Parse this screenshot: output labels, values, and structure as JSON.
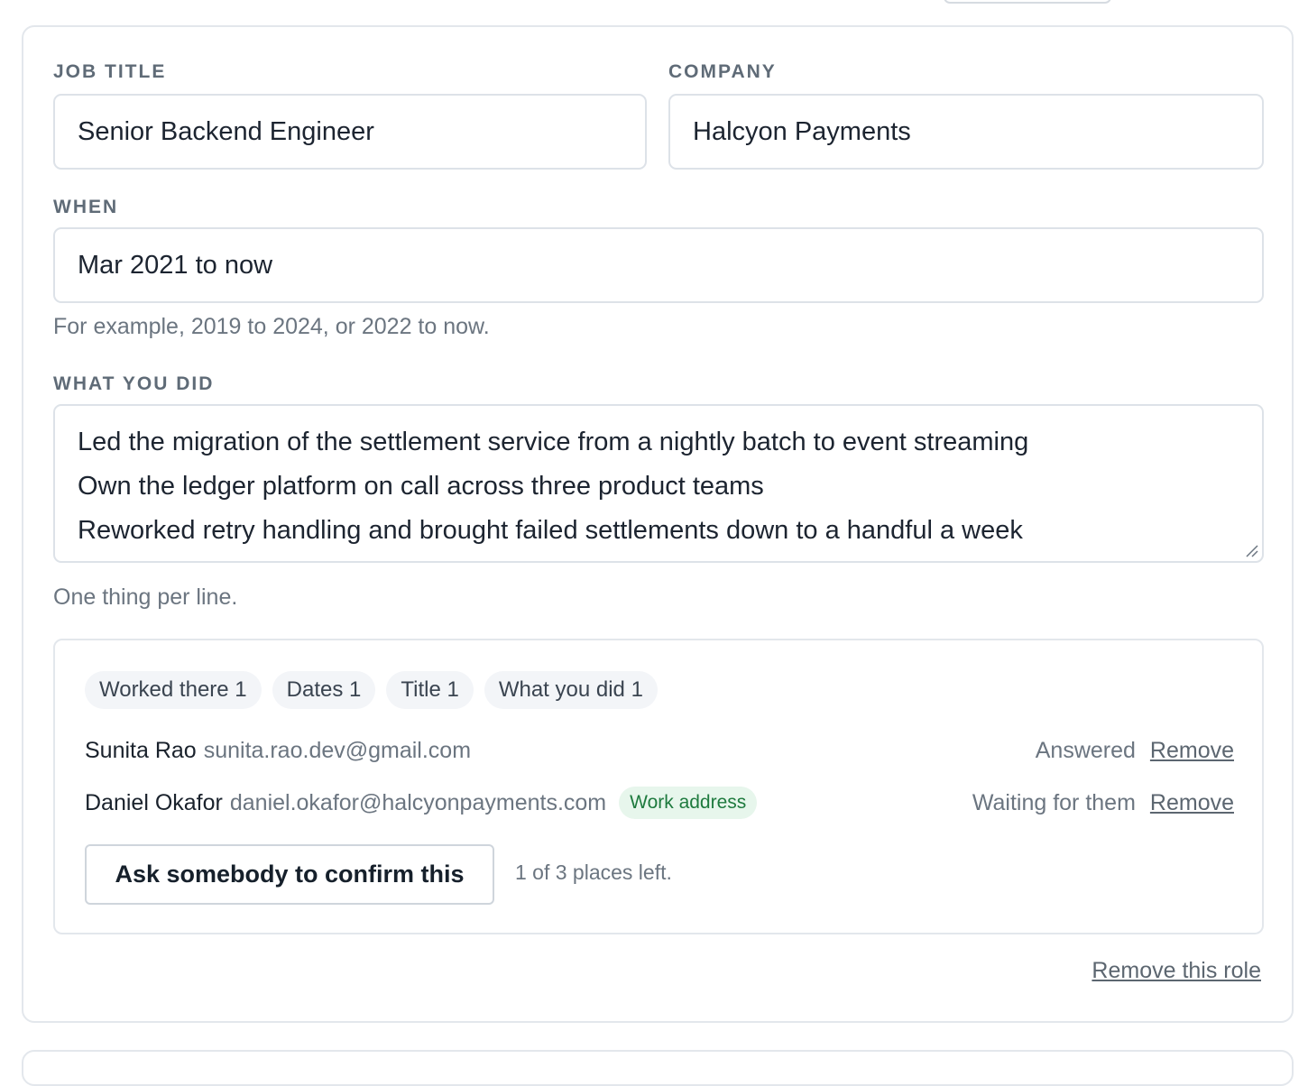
{
  "role": {
    "job_title_label": "JOB TITLE",
    "job_title_value": "Senior Backend Engineer",
    "company_label": "COMPANY",
    "company_value": "Halcyon Payments",
    "when_label": "WHEN",
    "when_value": "Mar 2021 to now",
    "when_hint": "For example, 2019 to 2024, or 2022 to now.",
    "what_label": "WHAT YOU DID",
    "what_lines": [
      "Led the migration of the settlement service from a nightly batch to event streaming",
      "Own the ledger platform on call across three product teams",
      "Reworked retry handling and brought failed settlements down to a handful a week"
    ],
    "what_hint": "One thing per line.",
    "remove_role_label": "Remove this role"
  },
  "verification": {
    "chips": [
      {
        "label": "Worked there 1"
      },
      {
        "label": "Dates 1"
      },
      {
        "label": "Title 1"
      },
      {
        "label": "What you did 1"
      }
    ],
    "people": [
      {
        "name": "Sunita Rao",
        "email": "sunita.rao.dev@gmail.com",
        "badge": "",
        "status": "Answered",
        "remove_label": "Remove"
      },
      {
        "name": "Daniel Okafor",
        "email": "daniel.okafor@halcyonpayments.com",
        "badge": "Work address",
        "status": "Waiting for them",
        "remove_label": "Remove"
      }
    ],
    "ask_button_label": "Ask somebody to confirm this",
    "places_left": "1 of 3 places left."
  },
  "colors": {
    "badge_bg": "#e7f6ec",
    "badge_text": "#1e7a3e",
    "border": "#e3e7ec"
  }
}
